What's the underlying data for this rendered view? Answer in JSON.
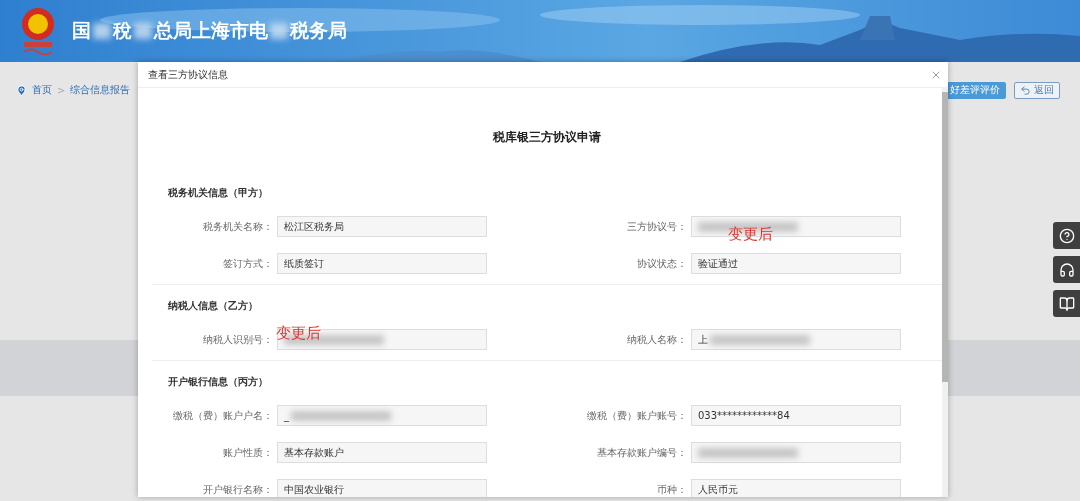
{
  "header": {
    "title_parts": [
      "国",
      "稅",
      "总局上海市电",
      "税务局"
    ]
  },
  "breadcrumb": [
    {
      "label": "首页"
    },
    {
      "separator": ">",
      "label": "综合信息报告"
    }
  ],
  "actions": [
    {
      "kind": "primary",
      "label": "好差评评价"
    },
    {
      "kind": "back",
      "label": "返回"
    }
  ],
  "side_tools": [
    {
      "kind": "help"
    },
    {
      "kind": "service"
    },
    {
      "kind": "manual"
    }
  ],
  "dialog": {
    "title": "查看三方协议信息",
    "heading": "税库银三方协议申请",
    "sections": [
      {
        "title": "税务机关信息（甲方）",
        "fields": [
          {
            "label": "税务机关名称：",
            "value": "松江区税务局",
            "redacted": false
          },
          {
            "label": "三方协议号：",
            "redacted": true,
            "annotation": "变更后"
          },
          {
            "label": "签订方式：",
            "value": "纸质签订",
            "redacted": false
          },
          {
            "label": "协议状态：",
            "value": "验证通过",
            "redacted": false
          }
        ]
      },
      {
        "title": "纳税人信息（乙方）",
        "fields": [
          {
            "label": "纳税人识别号：",
            "redacted": true,
            "annotation": "变更后"
          },
          {
            "label": "纳税人名称：",
            "value": "上",
            "redacted": true
          }
        ]
      },
      {
        "title": "开户银行信息（丙方）",
        "fields": [
          {
            "label": "缴税（费）账户户名：",
            "value": "_",
            "redacted": true
          },
          {
            "label": "缴税（费）账户账号：",
            "value": "033************84",
            "redacted": false
          },
          {
            "label": "账户性质：",
            "value": "基本存款账户",
            "redacted": false
          },
          {
            "label": "基本存款账户编号：",
            "redacted": true
          },
          {
            "label": "开户银行名称：",
            "value": "中国农业银行",
            "redacted": false
          },
          {
            "label": "币种：",
            "value": "人民币元",
            "redacted": false
          }
        ]
      }
    ]
  }
}
